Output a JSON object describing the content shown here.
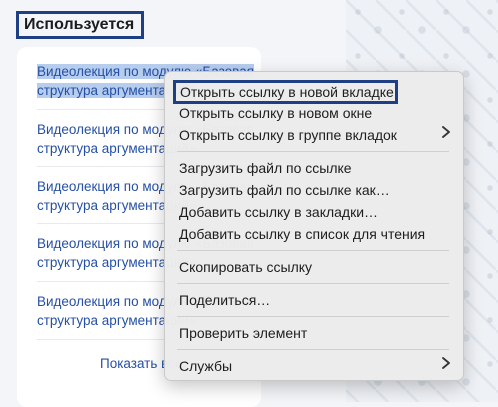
{
  "section": {
    "title": "Используется"
  },
  "lectures": [
    {
      "line1": "Видеолекция по модулю «Базовая",
      "line2": "структура аргументаций»"
    },
    {
      "line1": "Видеолекция по модулю «Базовая",
      "line2": "структура аргументаций»"
    },
    {
      "line1": "Видеолекция по модулю «Базовая",
      "line2": "структура аргументаций»"
    },
    {
      "line1": "Видеолекция по модулю «Базовая",
      "line2": "структура аргументаций»"
    },
    {
      "line1": "Видеолекция по модулю «Базовая",
      "line2": "структура аргументаций»"
    }
  ],
  "show_all_label": "Показать все",
  "context_menu": {
    "items": [
      {
        "label": "Открыть ссылку в новой вкладке",
        "icon": ""
      },
      {
        "label": "Открыть ссылку в новом окне",
        "icon": ""
      },
      {
        "label": "Открыть ссылку в группе вкладок",
        "icon": "chevron-right-icon"
      },
      {
        "label": "Загрузить файл по ссылке",
        "icon": ""
      },
      {
        "label": "Загрузить файл по ссылке как…",
        "icon": ""
      },
      {
        "label": "Добавить ссылку в закладки…",
        "icon": ""
      },
      {
        "label": "Добавить ссылку в список для чтения",
        "icon": ""
      },
      {
        "label": "Скопировать ссылку",
        "icon": ""
      },
      {
        "label": "Поделиться…",
        "icon": ""
      },
      {
        "label": "Проверить элемент",
        "icon": ""
      },
      {
        "label": "Службы",
        "icon": "chevron-right-icon"
      }
    ]
  },
  "colors": {
    "link": "#2550a5",
    "highlight_border": "#1f3f85",
    "selection": "#b7cdee"
  }
}
